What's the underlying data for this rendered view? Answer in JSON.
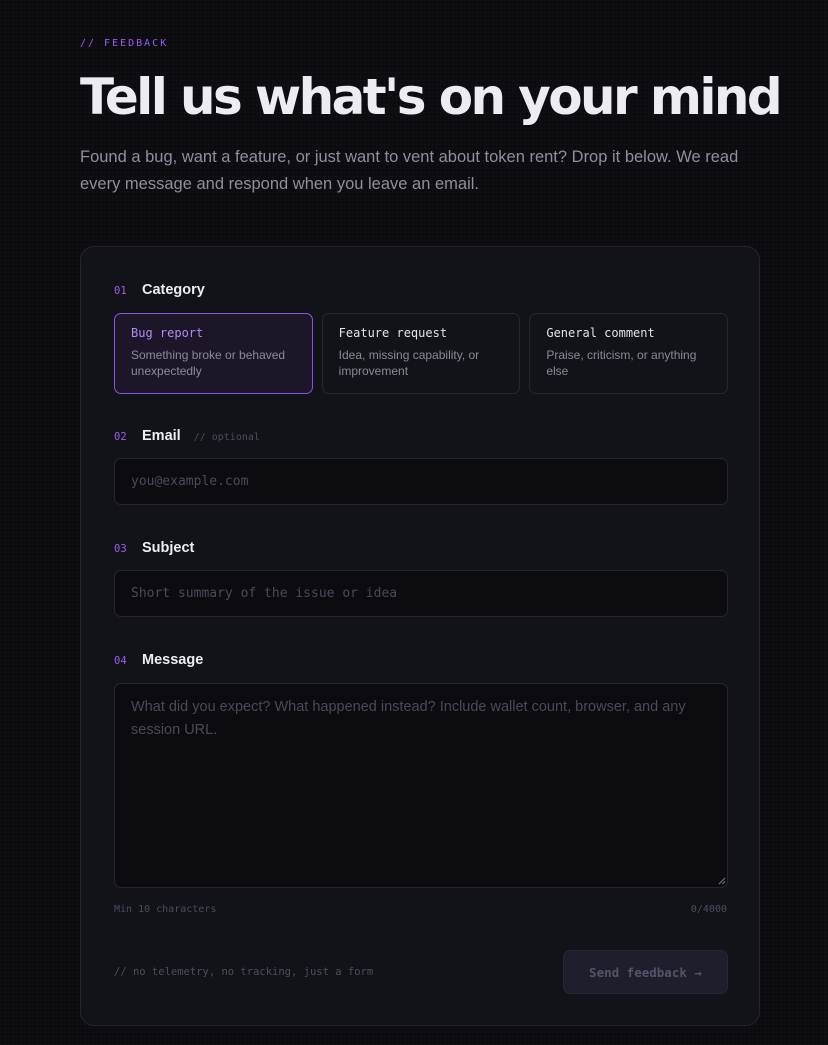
{
  "header": {
    "eyebrow": "// FEEDBACK",
    "title": "Tell us what's on your mind",
    "lede": "Found a bug, want a feature, or just want to vent about token rent? Drop it below. We read every message and respond when you leave an email."
  },
  "form": {
    "category": {
      "number": "01",
      "label": "Category",
      "options": [
        {
          "title": "Bug report",
          "description": "Something broke or behaved unexpectedly",
          "selected": true
        },
        {
          "title": "Feature request",
          "description": "Idea, missing capability, or improvement",
          "selected": false
        },
        {
          "title": "General comment",
          "description": "Praise, criticism, or anything else",
          "selected": false
        }
      ]
    },
    "email": {
      "number": "02",
      "label": "Email",
      "hint": "// optional",
      "value": "",
      "placeholder": "you@example.com"
    },
    "subject": {
      "number": "03",
      "label": "Subject",
      "value": "",
      "placeholder": "Short summary of the issue or idea"
    },
    "message": {
      "number": "04",
      "label": "Message",
      "value": "",
      "placeholder": "What did you expect? What happened instead? Include wallet count, browser, and any session URL.",
      "min_hint": "Min 10 characters",
      "counter": "0/4000"
    },
    "footnote": "// no telemetry, no tracking, just a form",
    "submit_label": "Send feedback →"
  },
  "colors": {
    "accent": "#9a5cf0",
    "selected_border": "#8b52e6",
    "background": "#0b0b10",
    "card": "#121219"
  }
}
